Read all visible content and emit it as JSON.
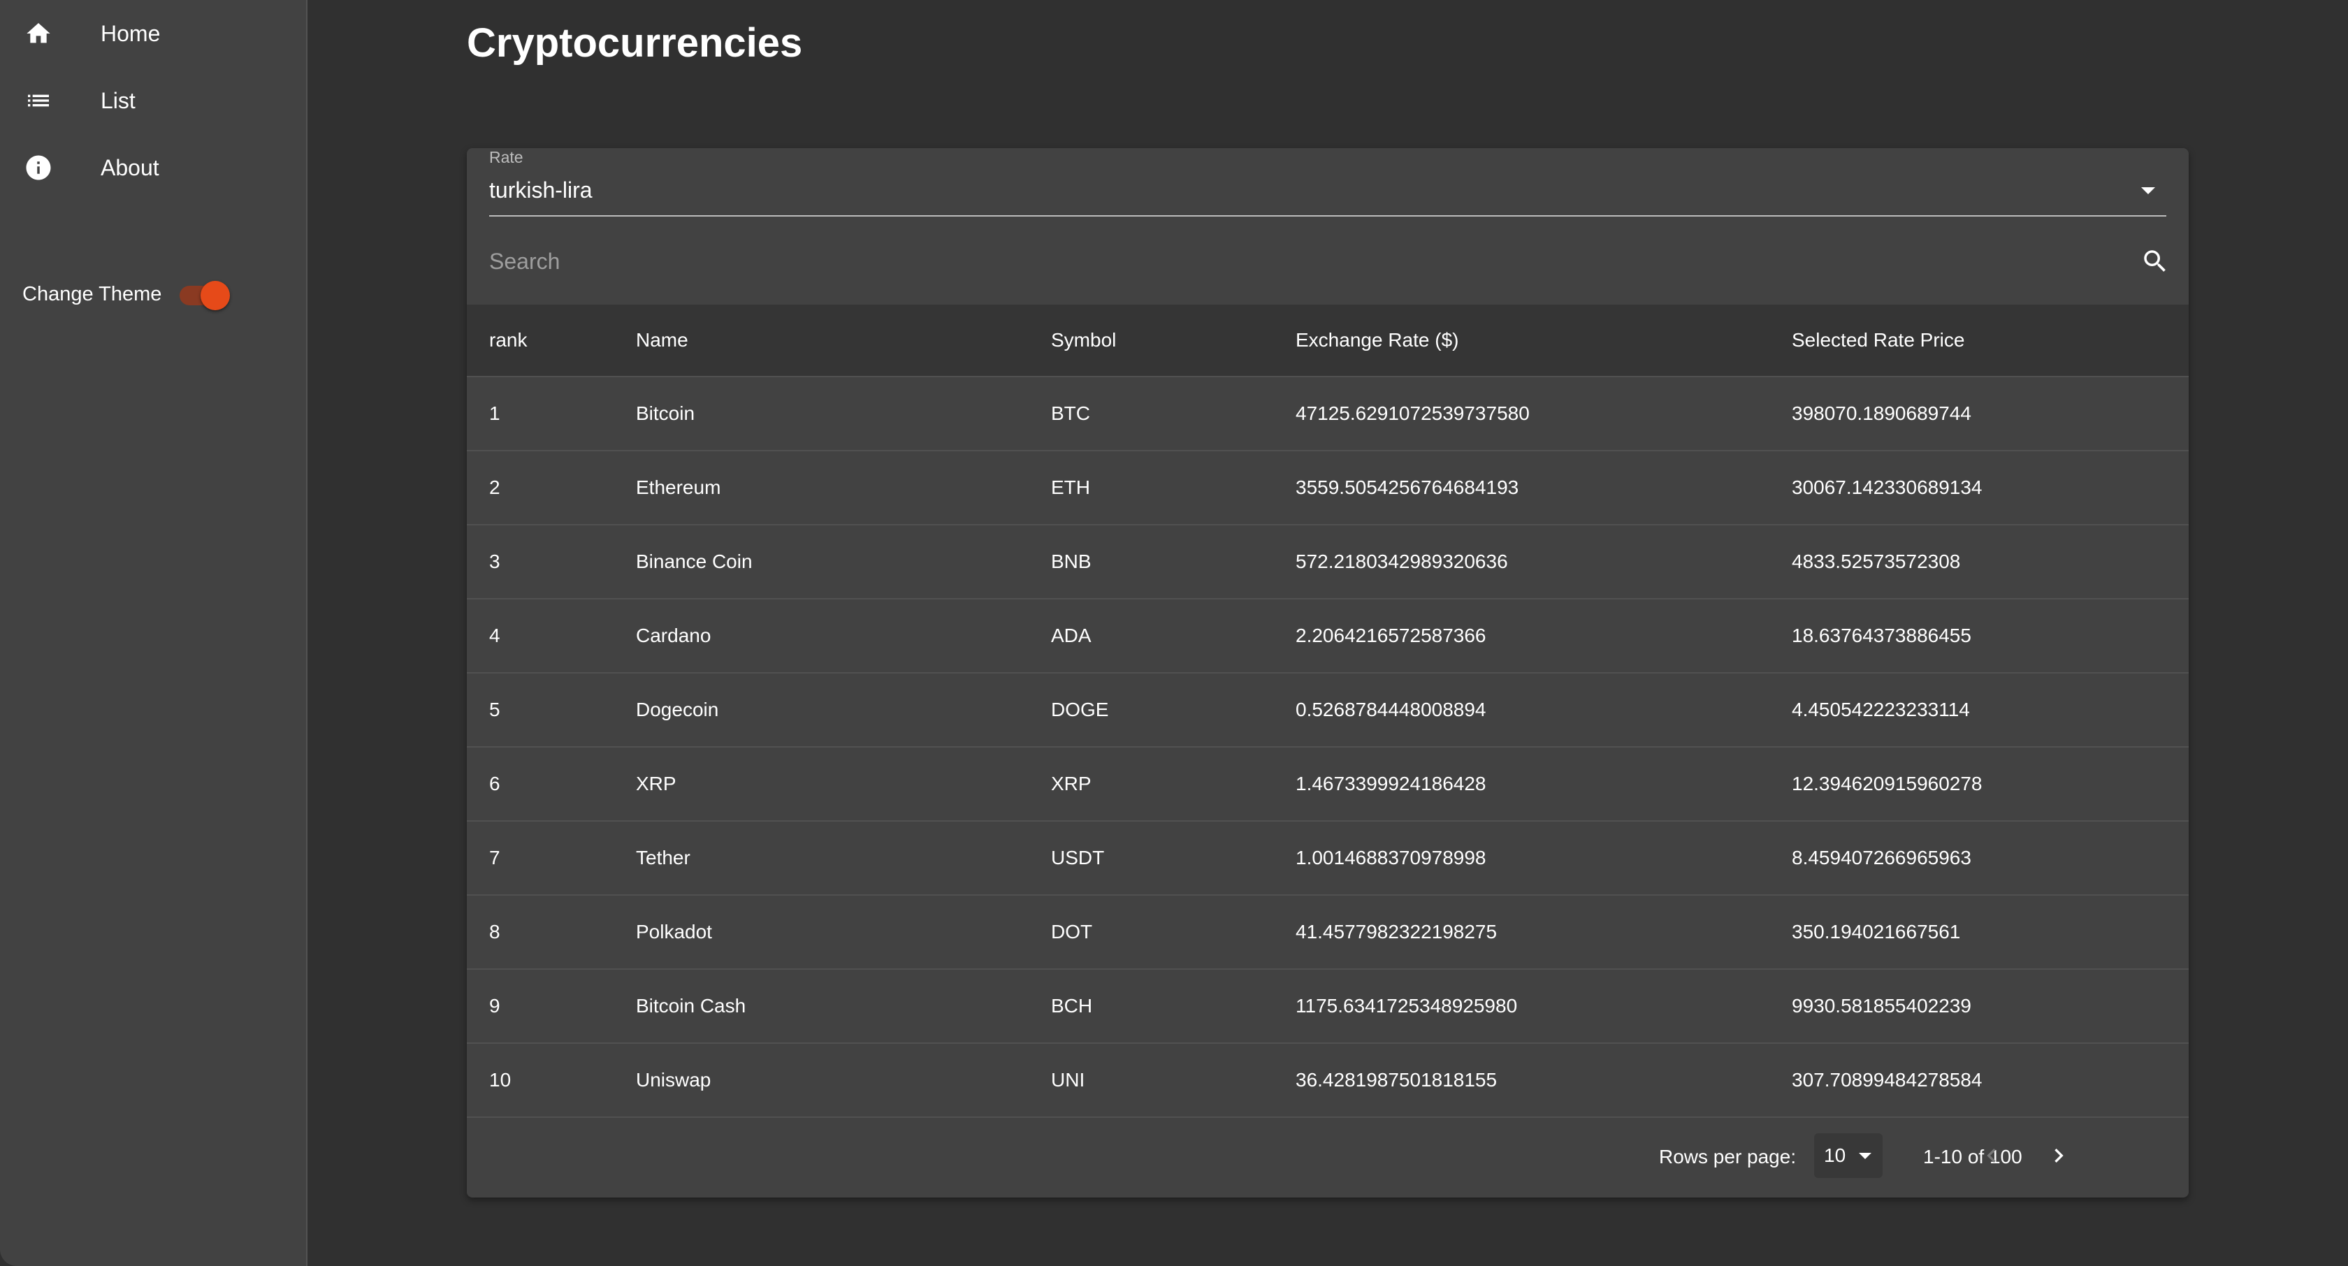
{
  "sidebar": {
    "items": [
      {
        "label": "Home",
        "icon": "home-icon"
      },
      {
        "label": "List",
        "icon": "list-icon"
      },
      {
        "label": "About",
        "icon": "info-icon"
      }
    ],
    "theme_label": "Change Theme",
    "theme_toggle_on": true
  },
  "main": {
    "title": "Cryptocurrencies",
    "rate": {
      "label": "Rate",
      "value": "turkish-lira"
    },
    "search": {
      "placeholder": "Search"
    },
    "table": {
      "columns": [
        "rank",
        "Name",
        "Symbol",
        "Exchange Rate ($)",
        "Selected Rate Price"
      ],
      "rows": [
        [
          "1",
          "Bitcoin",
          "BTC",
          "47125.6291072539737580",
          "398070.1890689744"
        ],
        [
          "2",
          "Ethereum",
          "ETH",
          "3559.5054256764684193",
          "30067.142330689134"
        ],
        [
          "3",
          "Binance Coin",
          "BNB",
          "572.2180342989320636",
          "4833.52573572308"
        ],
        [
          "4",
          "Cardano",
          "ADA",
          "2.2064216572587366",
          "18.63764373886455"
        ],
        [
          "5",
          "Dogecoin",
          "DOGE",
          "0.5268784448008894",
          "4.450542223233114"
        ],
        [
          "6",
          "XRP",
          "XRP",
          "1.4673399924186428",
          "12.394620915960278"
        ],
        [
          "7",
          "Tether",
          "USDT",
          "1.0014688370978998",
          "8.459407266965963"
        ],
        [
          "8",
          "Polkadot",
          "DOT",
          "41.4577982322198275",
          "350.194021667561"
        ],
        [
          "9",
          "Bitcoin Cash",
          "BCH",
          "1175.6341725348925980",
          "9930.581855402239"
        ],
        [
          "10",
          "Uniswap",
          "UNI",
          "36.4281987501818155",
          "307.70899484278584"
        ]
      ]
    },
    "pagination": {
      "rows_per_page_label": "Rows per page:",
      "rows_per_page": "10",
      "range": "1-10 of 100"
    }
  },
  "colors": {
    "background": "#303030",
    "surface": "#424242",
    "accent": "#e64a19"
  }
}
